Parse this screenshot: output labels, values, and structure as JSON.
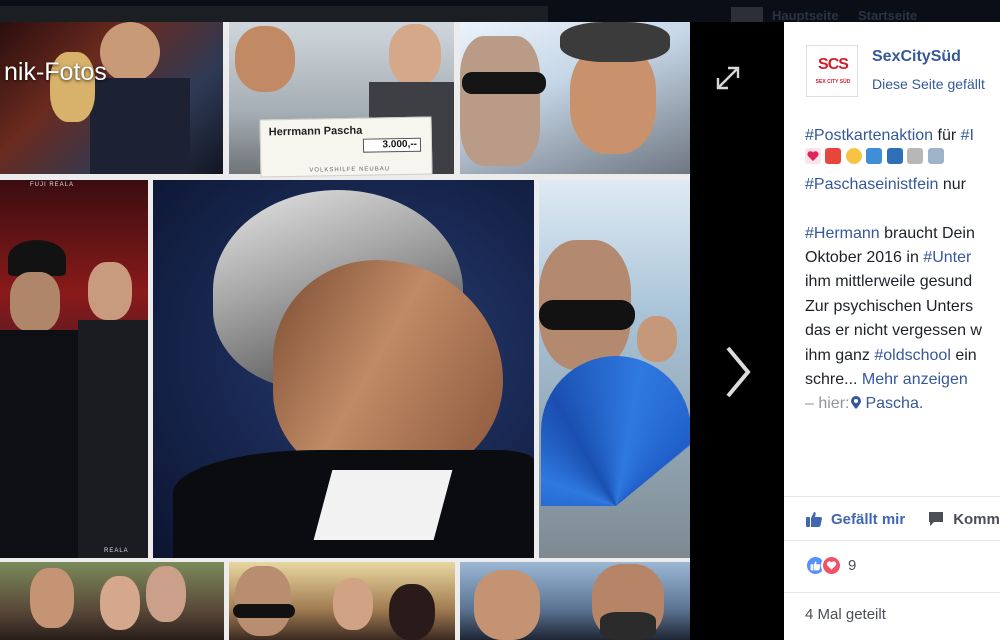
{
  "header": {
    "links": [
      "Hauptseite",
      "Startseite"
    ]
  },
  "photo": {
    "album_title": "nik-Fotos",
    "cheque_payee": "Herrmann Pascha",
    "cheque_amount": "3.000,--",
    "cheque_org": "VOLKSHILFE NEUBAU",
    "film_label_1": "FUJI REALA",
    "film_label_2": "REALA"
  },
  "page": {
    "name": "SexCitySüd",
    "subtitle": "Diese Seite gefällt",
    "logo_mark": "SCS",
    "logo_tag": "SEX CITY SÜD"
  },
  "post": {
    "line1": {
      "tag1": "#Postkartenaktion",
      "text": " für ",
      "tag2": "#I"
    },
    "line3": {
      "tag": "#Paschaseinistfein",
      "text": " nur "
    },
    "line4": {
      "tag": "#Hermann",
      "text": " braucht Dein"
    },
    "line5": {
      "text": "Oktober 2016 in ",
      "tag": "#Unter"
    },
    "line6": "ihm mittlerweile gesund",
    "line7": "Zur psychischen Unters",
    "line8": "das er nicht vergessen w",
    "line9": {
      "text": "ihm ganz ",
      "tag": "#oldschool",
      "text2": " ein"
    },
    "line10": {
      "text": "schre... ",
      "more": "Mehr anzeigen"
    },
    "line11": {
      "prefix": "– hier:",
      "place": "Pascha."
    }
  },
  "actions": {
    "like": "Gefällt mir",
    "comment": "Komm"
  },
  "reactions": {
    "count": "9"
  },
  "shares": "4 Mal geteilt",
  "colors": {
    "link": "#365899",
    "text": "#1d2129",
    "muted": "#4b4f56",
    "like_blue": "#5890ff",
    "love_red": "#f25268",
    "brand_red": "#d11d2a"
  }
}
